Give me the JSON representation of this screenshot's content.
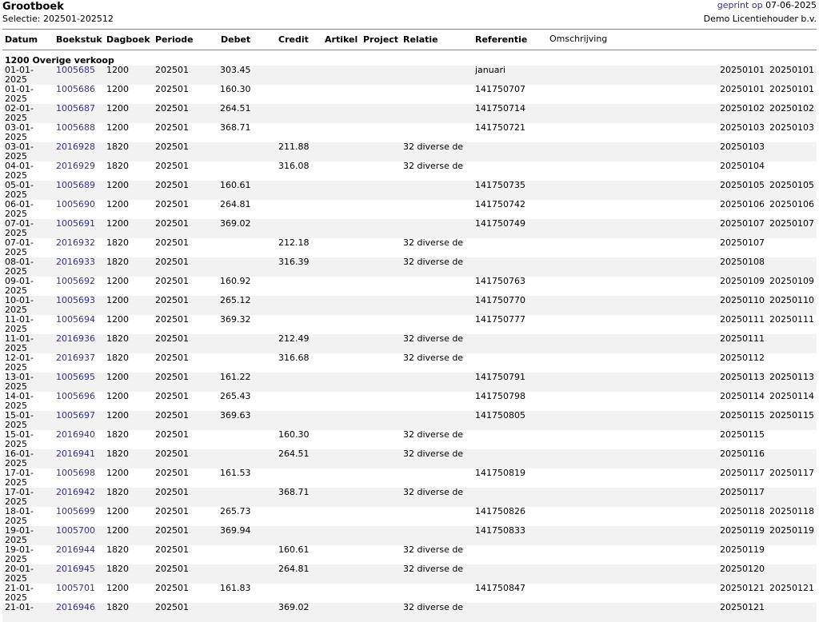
{
  "header": {
    "title": "Grootboek",
    "selection": "Selectie: 202501-202512",
    "printed_label": "geprint op",
    "printed_date": "07-06-2025",
    "licensee": "Demo Licentiehouder b.v."
  },
  "columns": {
    "datum": "Datum",
    "boekstuk": "Boekstuk",
    "dagboek": "Dagboek",
    "periode": "Periode",
    "debet": "Debet",
    "credit": "Credit",
    "artikel": "Artikel",
    "project": "Project",
    "relatie": "Relatie",
    "referentie": "Referentie",
    "omschrijving": "Omschrijving"
  },
  "group_title": "1200 Overige verkoop",
  "rows": [
    {
      "date": "01-01-2025",
      "boekstuk": "1005685",
      "dagboek": "1200",
      "periode": "202501",
      "debet": "303.45",
      "credit": "",
      "relatie": "",
      "referentie": "januari",
      "x1": "20250101",
      "x2": "20250101"
    },
    {
      "date": "01-01-2025",
      "boekstuk": "1005686",
      "dagboek": "1200",
      "periode": "202501",
      "debet": "160.30",
      "credit": "",
      "relatie": "",
      "referentie": "141750707",
      "x1": "20250101",
      "x2": "20250101"
    },
    {
      "date": "02-01-2025",
      "boekstuk": "1005687",
      "dagboek": "1200",
      "periode": "202501",
      "debet": "264.51",
      "credit": "",
      "relatie": "",
      "referentie": "141750714",
      "x1": "20250102",
      "x2": "20250102"
    },
    {
      "date": "03-01-2025",
      "boekstuk": "1005688",
      "dagboek": "1200",
      "periode": "202501",
      "debet": "368.71",
      "credit": "",
      "relatie": "",
      "referentie": "141750721",
      "x1": "20250103",
      "x2": "20250103"
    },
    {
      "date": "03-01-2025",
      "boekstuk": "2016928",
      "dagboek": "1820",
      "periode": "202501",
      "debet": "",
      "credit": "211.88",
      "relatie": "32 diverse de",
      "referentie": "",
      "x1": "20250103",
      "x2": ""
    },
    {
      "date": "04-01-2025",
      "boekstuk": "2016929",
      "dagboek": "1820",
      "periode": "202501",
      "debet": "",
      "credit": "316.08",
      "relatie": "32 diverse de",
      "referentie": "",
      "x1": "20250104",
      "x2": ""
    },
    {
      "date": "05-01-2025",
      "boekstuk": "1005689",
      "dagboek": "1200",
      "periode": "202501",
      "debet": "160.61",
      "credit": "",
      "relatie": "",
      "referentie": "141750735",
      "x1": "20250105",
      "x2": "20250105"
    },
    {
      "date": "06-01-2025",
      "boekstuk": "1005690",
      "dagboek": "1200",
      "periode": "202501",
      "debet": "264.81",
      "credit": "",
      "relatie": "",
      "referentie": "141750742",
      "x1": "20250106",
      "x2": "20250106"
    },
    {
      "date": "07-01-2025",
      "boekstuk": "1005691",
      "dagboek": "1200",
      "periode": "202501",
      "debet": "369.02",
      "credit": "",
      "relatie": "",
      "referentie": "141750749",
      "x1": "20250107",
      "x2": "20250107"
    },
    {
      "date": "07-01-2025",
      "boekstuk": "2016932",
      "dagboek": "1820",
      "periode": "202501",
      "debet": "",
      "credit": "212.18",
      "relatie": "32 diverse de",
      "referentie": "",
      "x1": "20250107",
      "x2": ""
    },
    {
      "date": "08-01-2025",
      "boekstuk": "2016933",
      "dagboek": "1820",
      "periode": "202501",
      "debet": "",
      "credit": "316.39",
      "relatie": "32 diverse de",
      "referentie": "",
      "x1": "20250108",
      "x2": ""
    },
    {
      "date": "09-01-2025",
      "boekstuk": "1005692",
      "dagboek": "1200",
      "periode": "202501",
      "debet": "160.92",
      "credit": "",
      "relatie": "",
      "referentie": "141750763",
      "x1": "20250109",
      "x2": "20250109"
    },
    {
      "date": "10-01-2025",
      "boekstuk": "1005693",
      "dagboek": "1200",
      "periode": "202501",
      "debet": "265.12",
      "credit": "",
      "relatie": "",
      "referentie": "141750770",
      "x1": "20250110",
      "x2": "20250110"
    },
    {
      "date": "11-01-2025",
      "boekstuk": "1005694",
      "dagboek": "1200",
      "periode": "202501",
      "debet": "369.32",
      "credit": "",
      "relatie": "",
      "referentie": "141750777",
      "x1": "20250111",
      "x2": "20250111"
    },
    {
      "date": "11-01-2025",
      "boekstuk": "2016936",
      "dagboek": "1820",
      "periode": "202501",
      "debet": "",
      "credit": "212.49",
      "relatie": "32 diverse de",
      "referentie": "",
      "x1": "20250111",
      "x2": ""
    },
    {
      "date": "12-01-2025",
      "boekstuk": "2016937",
      "dagboek": "1820",
      "periode": "202501",
      "debet": "",
      "credit": "316.68",
      "relatie": "32 diverse de",
      "referentie": "",
      "x1": "20250112",
      "x2": ""
    },
    {
      "date": "13-01-2025",
      "boekstuk": "1005695",
      "dagboek": "1200",
      "periode": "202501",
      "debet": "161.22",
      "credit": "",
      "relatie": "",
      "referentie": "141750791",
      "x1": "20250113",
      "x2": "20250113"
    },
    {
      "date": "14-01-2025",
      "boekstuk": "1005696",
      "dagboek": "1200",
      "periode": "202501",
      "debet": "265.43",
      "credit": "",
      "relatie": "",
      "referentie": "141750798",
      "x1": "20250114",
      "x2": "20250114"
    },
    {
      "date": "15-01-2025",
      "boekstuk": "1005697",
      "dagboek": "1200",
      "periode": "202501",
      "debet": "369.63",
      "credit": "",
      "relatie": "",
      "referentie": "141750805",
      "x1": "20250115",
      "x2": "20250115"
    },
    {
      "date": "15-01-2025",
      "boekstuk": "2016940",
      "dagboek": "1820",
      "periode": "202501",
      "debet": "",
      "credit": "160.30",
      "relatie": "32 diverse de",
      "referentie": "",
      "x1": "20250115",
      "x2": ""
    },
    {
      "date": "16-01-2025",
      "boekstuk": "2016941",
      "dagboek": "1820",
      "periode": "202501",
      "debet": "",
      "credit": "264.51",
      "relatie": "32 diverse de",
      "referentie": "",
      "x1": "20250116",
      "x2": ""
    },
    {
      "date": "17-01-2025",
      "boekstuk": "1005698",
      "dagboek": "1200",
      "periode": "202501",
      "debet": "161.53",
      "credit": "",
      "relatie": "",
      "referentie": "141750819",
      "x1": "20250117",
      "x2": "20250117"
    },
    {
      "date": "17-01-2025",
      "boekstuk": "2016942",
      "dagboek": "1820",
      "periode": "202501",
      "debet": "",
      "credit": "368.71",
      "relatie": "32 diverse de",
      "referentie": "",
      "x1": "20250117",
      "x2": ""
    },
    {
      "date": "18-01-2025",
      "boekstuk": "1005699",
      "dagboek": "1200",
      "periode": "202501",
      "debet": "265.73",
      "credit": "",
      "relatie": "",
      "referentie": "141750826",
      "x1": "20250118",
      "x2": "20250118"
    },
    {
      "date": "19-01-2025",
      "boekstuk": "1005700",
      "dagboek": "1200",
      "periode": "202501",
      "debet": "369.94",
      "credit": "",
      "relatie": "",
      "referentie": "141750833",
      "x1": "20250119",
      "x2": "20250119"
    },
    {
      "date": "19-01-2025",
      "boekstuk": "2016944",
      "dagboek": "1820",
      "periode": "202501",
      "debet": "",
      "credit": "160.61",
      "relatie": "32 diverse de",
      "referentie": "",
      "x1": "20250119",
      "x2": ""
    },
    {
      "date": "20-01-2025",
      "boekstuk": "2016945",
      "dagboek": "1820",
      "periode": "202501",
      "debet": "",
      "credit": "264.81",
      "relatie": "32 diverse de",
      "referentie": "",
      "x1": "20250120",
      "x2": ""
    },
    {
      "date": "21-01-2025",
      "boekstuk": "1005701",
      "dagboek": "1200",
      "periode": "202501",
      "debet": "161.83",
      "credit": "",
      "relatie": "",
      "referentie": "141750847",
      "x1": "20250121",
      "x2": "20250121"
    },
    {
      "date": "21-01-",
      "boekstuk": "2016946",
      "dagboek": "1820",
      "periode": "202501",
      "debet": "",
      "credit": "369.02",
      "relatie": "32 diverse de",
      "referentie": "",
      "x1": "20250121",
      "x2": ""
    }
  ]
}
